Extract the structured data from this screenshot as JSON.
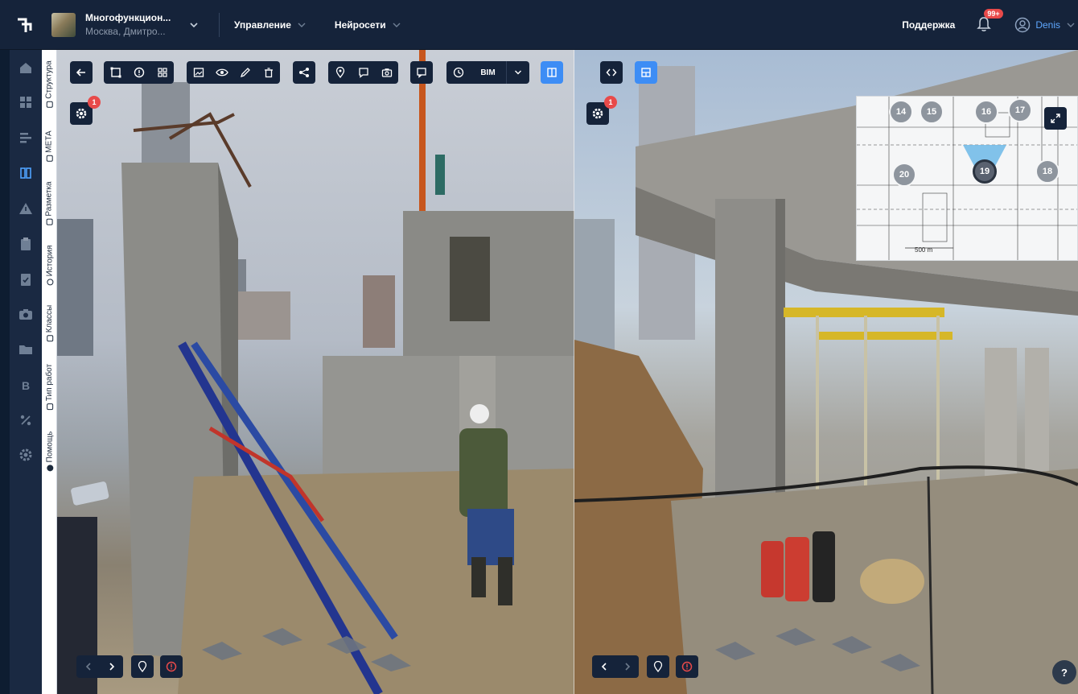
{
  "header": {
    "project_name": "Многофункцион...",
    "project_address": "Москва, Дмитро...",
    "menu": [
      {
        "label": "Управление"
      },
      {
        "label": "Нейросети"
      }
    ],
    "support_label": "Поддержка",
    "notifications_badge": "99+",
    "user_name": "Denis"
  },
  "sidebar": {
    "icons": [
      "home-icon",
      "dashboard-icon",
      "list-icon",
      "model-icon",
      "warning-icon",
      "clipboard-icon",
      "checklist-icon",
      "camera-icon",
      "folder-icon",
      "b-icon",
      "percent-icon",
      "gear-icon"
    ],
    "active_index": 3
  },
  "vertical_tabs": [
    {
      "label": "Структура"
    },
    {
      "label": "МЕТА"
    },
    {
      "label": "Разметка"
    },
    {
      "label": "История"
    },
    {
      "label": "Классы"
    },
    {
      "label": "Тип работ"
    },
    {
      "label": "Помощь"
    }
  ],
  "toolbar": {
    "bim_label": "BIM",
    "settings_badge_left": "1",
    "settings_badge_right": "1"
  },
  "minimap": {
    "points": [
      {
        "label": "14"
      },
      {
        "label": "15"
      },
      {
        "label": "16"
      },
      {
        "label": "17"
      },
      {
        "label": "20"
      },
      {
        "label": "19"
      },
      {
        "label": "18"
      }
    ],
    "current_point": "19",
    "scale_label": "500 m"
  },
  "help_label": "?",
  "colors": {
    "topbar": "#15233a",
    "sidebar": "#1a2942",
    "accent": "#3d8df5",
    "badge": "#e84a4a",
    "user_link": "#5fa8ff"
  }
}
